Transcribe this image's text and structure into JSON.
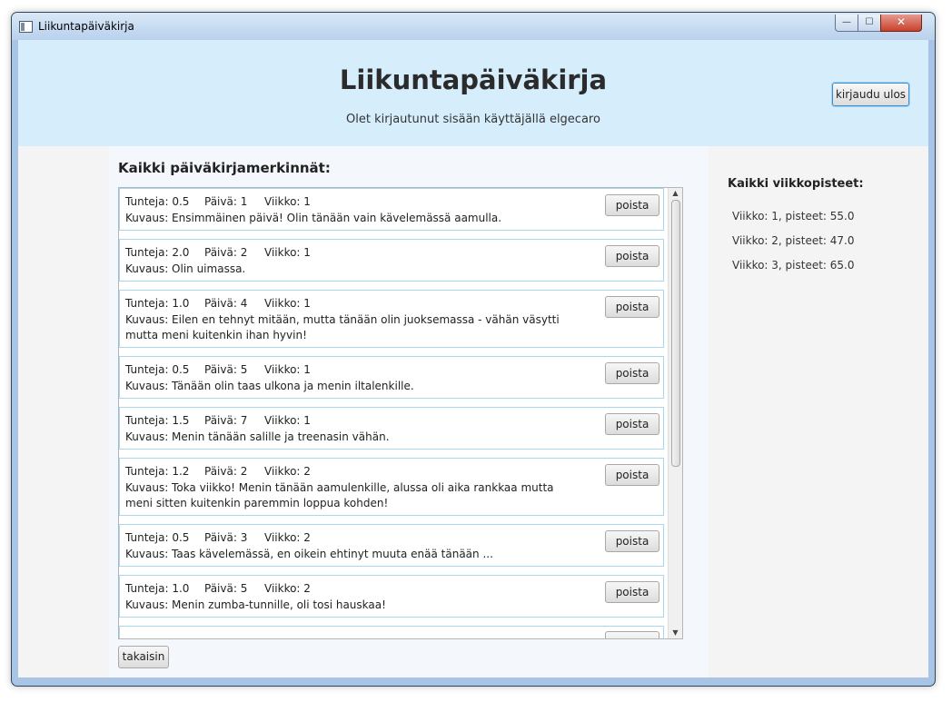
{
  "window": {
    "title": "Liikuntapäiväkirja",
    "controls": {
      "minimize": "—",
      "maximize": "☐",
      "close": "✕"
    }
  },
  "header": {
    "title": "Liikuntapäiväkirja",
    "login_info": "Olet kirjautunut sisään käyttäjällä elgecaro",
    "logout_label": "kirjaudu ulos"
  },
  "entries_section": {
    "title": "Kaikki päiväkirjamerkinnät:",
    "delete_label": "poista",
    "back_label": "takaisin",
    "entries": [
      {
        "hours": "Tunteja: 0.5",
        "day": "Päivä: 1",
        "week": "Viikko: 1",
        "desc": "Kuvaus: Ensimmäinen päivä! Olin tänään vain kävelemässä aamulla."
      },
      {
        "hours": "Tunteja: 2.0",
        "day": "Päivä: 2",
        "week": "Viikko: 1",
        "desc": "Kuvaus: Olin uimassa."
      },
      {
        "hours": "Tunteja: 1.0",
        "day": "Päivä: 4",
        "week": "Viikko: 1",
        "desc": "Kuvaus: Eilen en tehnyt mitään, mutta tänään olin juoksemassa - vähän väsytti mutta meni kuitenkin ihan hyvin!"
      },
      {
        "hours": "Tunteja: 0.5",
        "day": "Päivä: 5",
        "week": "Viikko: 1",
        "desc": "Kuvaus: Tänään olin taas ulkona ja menin iltalenkille."
      },
      {
        "hours": "Tunteja: 1.5",
        "day": "Päivä: 7",
        "week": "Viikko: 1",
        "desc": "Kuvaus: Menin tänään salille ja treenasin vähän."
      },
      {
        "hours": "Tunteja: 1.2",
        "day": "Päivä: 2",
        "week": "Viikko: 2",
        "desc": "Kuvaus: Toka viikko! Menin tänään aamulenkille, alussa oli aika rankkaa mutta meni sitten kuitenkin paremmin loppua kohden!"
      },
      {
        "hours": "Tunteja: 0.5",
        "day": "Päivä: 3",
        "week": "Viikko: 2",
        "desc": "Kuvaus: Taas kävelemässä, en oikein ehtinyt muuta enää tänään ..."
      },
      {
        "hours": "Tunteja: 1.0",
        "day": "Päivä: 5",
        "week": "Viikko: 2",
        "desc": "Kuvaus: Menin zumba-tunnille, oli tosi hauskaa!"
      }
    ]
  },
  "weekly_points": {
    "title": "Kaikki viikkopisteet:",
    "items": [
      "Viikko: 1, pisteet: 55.0",
      "Viikko: 2, pisteet: 47.0",
      "Viikko: 3, pisteet: 65.0"
    ]
  },
  "icons": {
    "scroll_up": "▲",
    "scroll_down": "▼"
  }
}
